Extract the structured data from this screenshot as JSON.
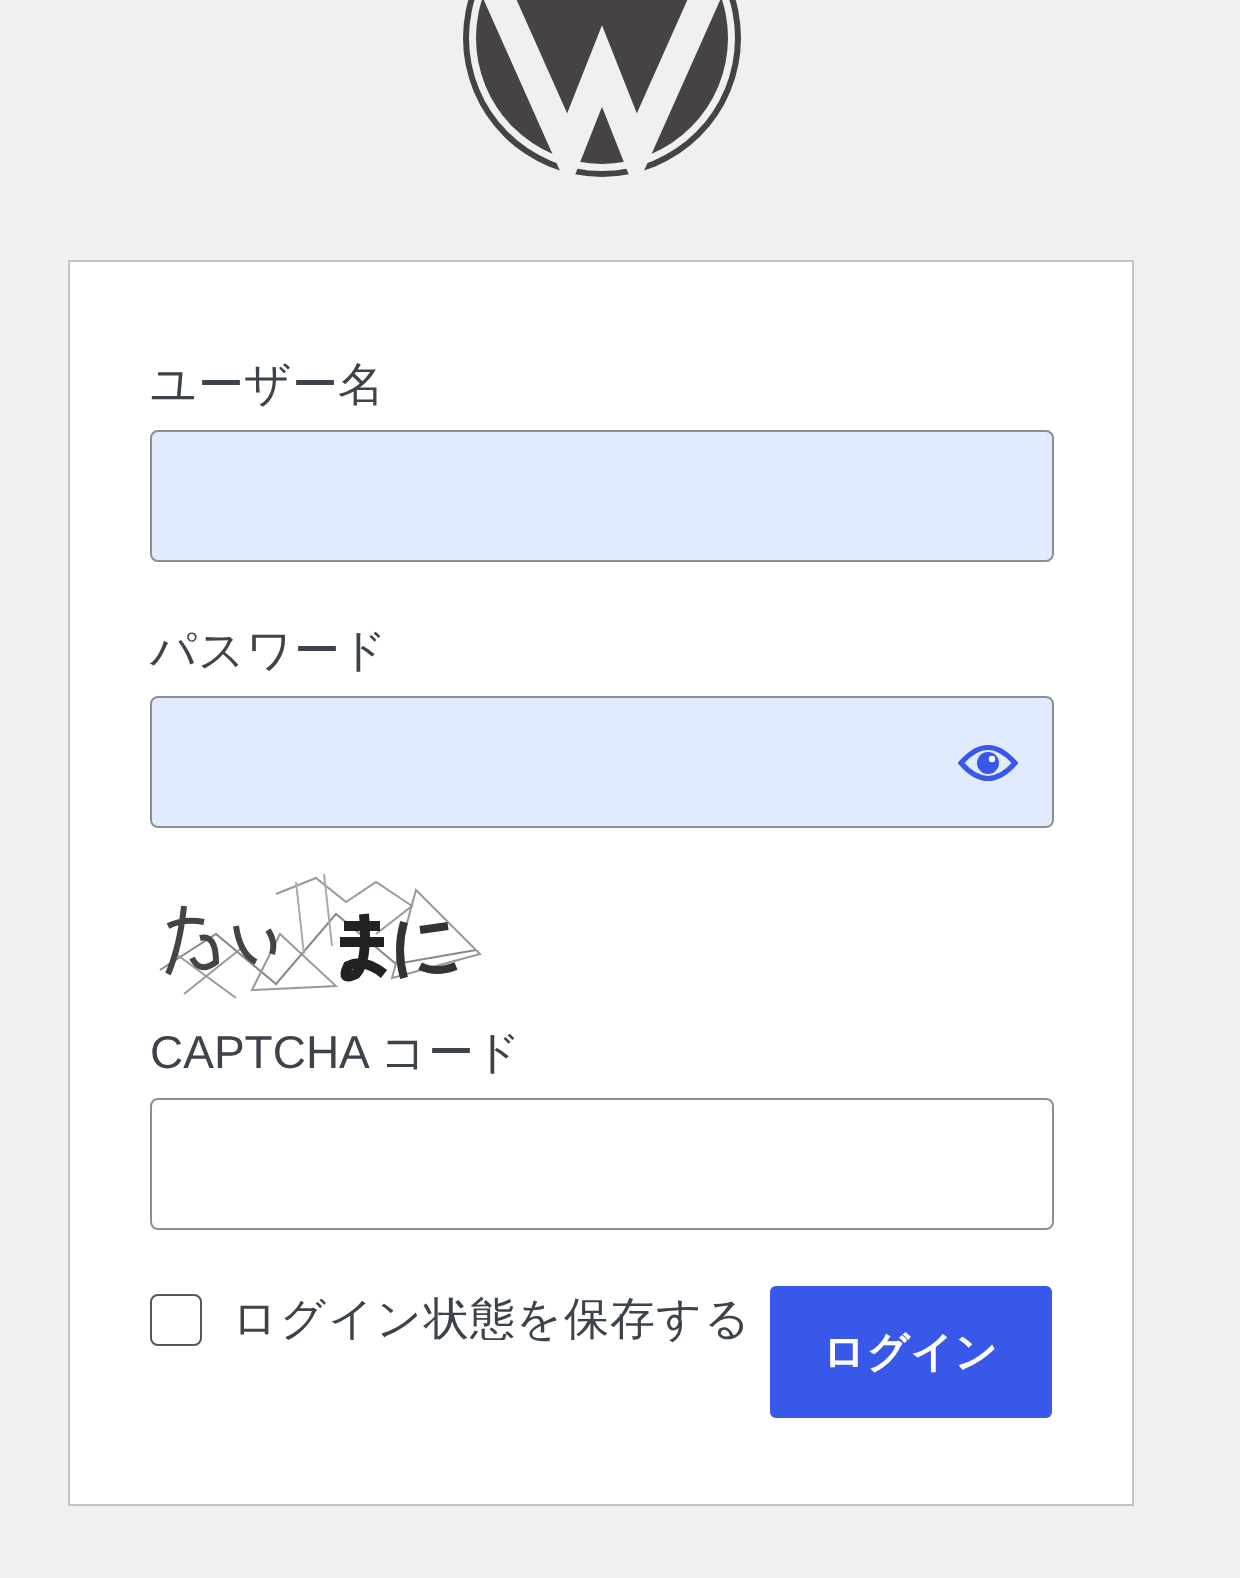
{
  "form": {
    "fields": [
      {
        "kind": "username",
        "label": "ユーザー名",
        "autofilled": true
      },
      {
        "kind": "password",
        "label": "パスワード",
        "autofilled": true
      },
      {
        "kind": "captcha",
        "label": "CAPTCHA コード",
        "autofilled": false
      }
    ],
    "remember": {
      "label": "ログイン状態を保存する",
      "checked": false
    },
    "submit": "ログイン"
  }
}
